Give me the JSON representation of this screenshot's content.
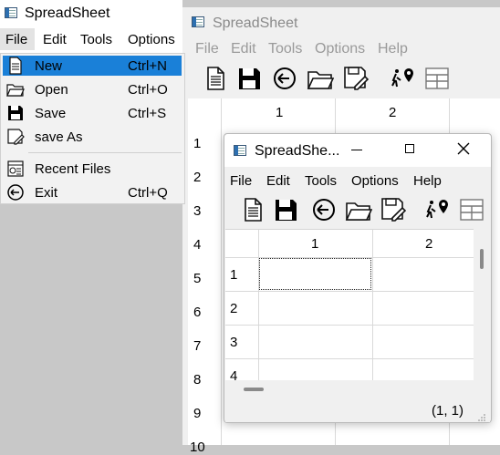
{
  "main_window": {
    "title": "SpreadSheet",
    "menu": [
      "File",
      "Edit",
      "Tools",
      "Options"
    ]
  },
  "file_menu": {
    "items": [
      {
        "label": "New",
        "shortcut": "Ctrl+N",
        "icon": "new-file-icon",
        "selected": true
      },
      {
        "label": "Open",
        "shortcut": "Ctrl+O",
        "icon": "folder-icon"
      },
      {
        "label": "Save",
        "shortcut": "Ctrl+S",
        "icon": "save-icon"
      },
      {
        "label": "save As",
        "shortcut": "",
        "icon": "save-as-icon"
      },
      {
        "label": "Recent Files",
        "shortcut": "",
        "icon": "recent-files-icon"
      },
      {
        "label": "Exit",
        "shortcut": "Ctrl+Q",
        "icon": "exit-icon"
      }
    ]
  },
  "background_window": {
    "title": "SpreadSheet",
    "menu": [
      "File",
      "Edit",
      "Tools",
      "Options",
      "Help"
    ],
    "col_headers": [
      "1",
      "2"
    ],
    "row_headers": [
      "1",
      "2",
      "3",
      "4",
      "5",
      "6",
      "7",
      "8",
      "9",
      "10"
    ]
  },
  "front_window": {
    "title": "SpreadShe...",
    "menu": [
      "File",
      "Edit",
      "Tools",
      "Options",
      "Help"
    ],
    "col_headers": [
      "1",
      "2"
    ],
    "row_headers": [
      "1",
      "2",
      "3",
      "4"
    ],
    "status": "(1, 1)"
  },
  "toolbar_icons": [
    "new-file-icon",
    "save-icon",
    "exit-icon",
    "folder-icon",
    "save-as-icon",
    "find-cell-icon",
    "grid-icon"
  ]
}
